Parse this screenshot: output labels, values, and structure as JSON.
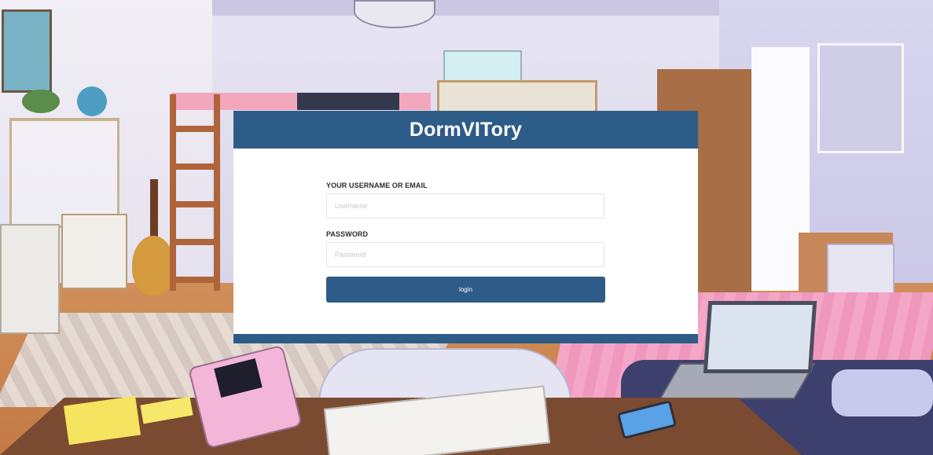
{
  "app": {
    "brand": "DormVITory"
  },
  "login_form": {
    "username": {
      "label": "YOUR USERNAME OR EMAIL",
      "placeholder": "Username",
      "value": ""
    },
    "password": {
      "label": "PASSWORD",
      "placeholder": "Password",
      "value": ""
    },
    "submit_label": "login"
  },
  "colors": {
    "brand_primary": "#2e5c88",
    "card_background": "#ffffff"
  }
}
